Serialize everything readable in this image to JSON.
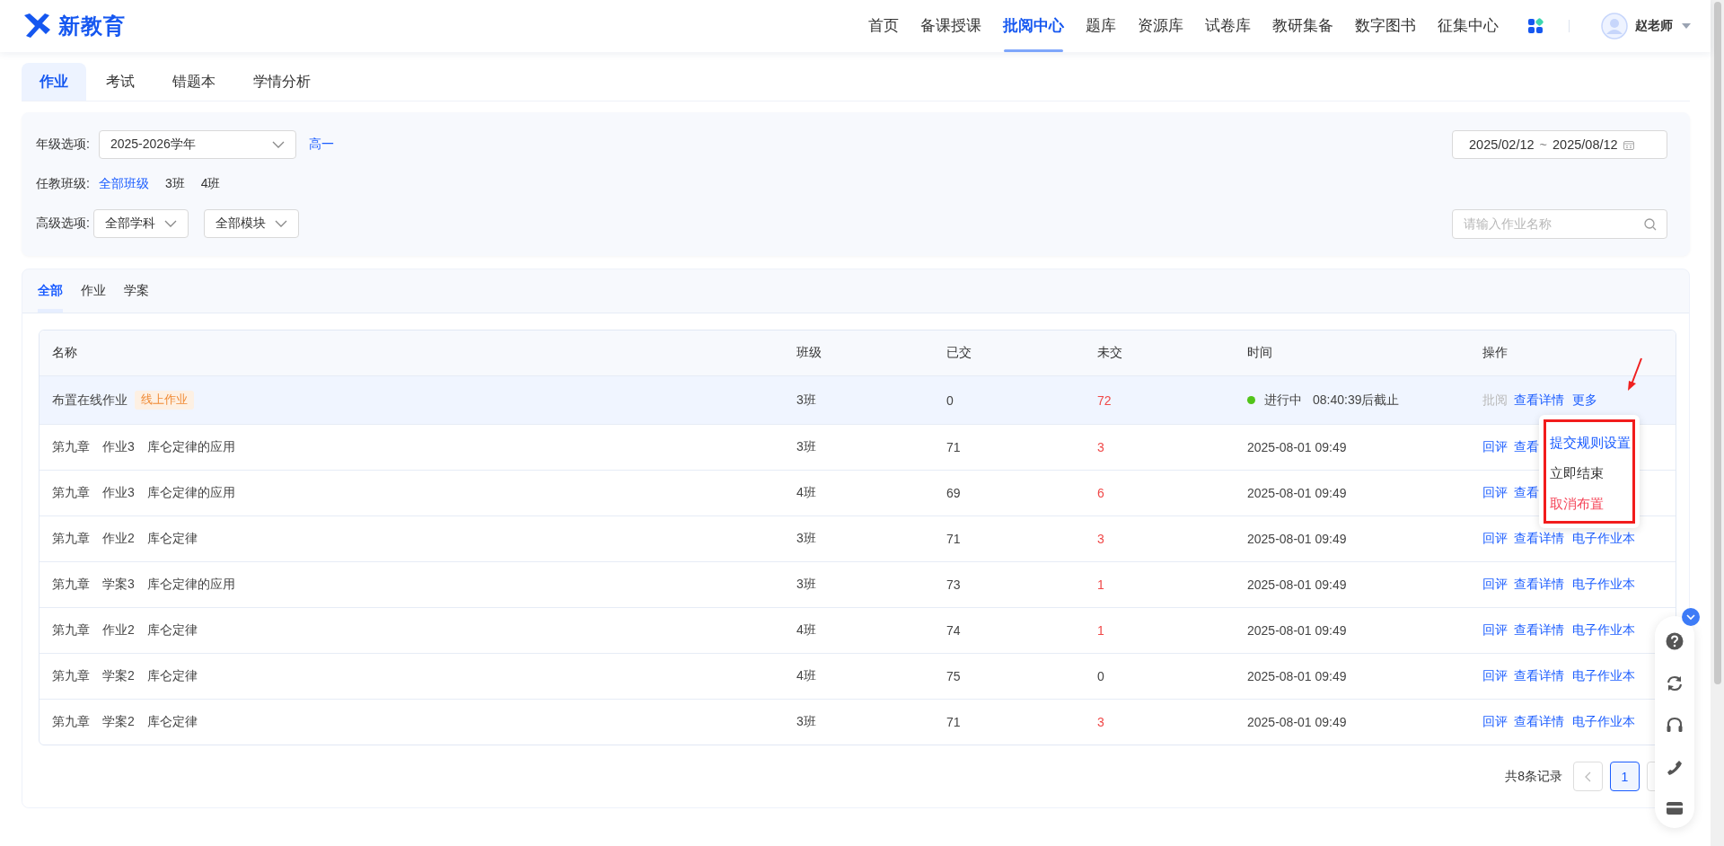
{
  "header": {
    "logo": "新教育",
    "nav": [
      {
        "label": "首页",
        "selected": false
      },
      {
        "label": "备课授课",
        "selected": false
      },
      {
        "label": "批阅中心",
        "selected": true
      },
      {
        "label": "题库",
        "selected": false
      },
      {
        "label": "资源库",
        "selected": false
      },
      {
        "label": "试卷库",
        "selected": false
      },
      {
        "label": "教研集备",
        "selected": false
      },
      {
        "label": "数字图书",
        "selected": false
      },
      {
        "label": "征集中心",
        "selected": false
      }
    ],
    "user": "赵老师"
  },
  "tabs": [
    {
      "label": "作业",
      "selected": true
    },
    {
      "label": "考试",
      "selected": false
    },
    {
      "label": "错题本",
      "selected": false
    },
    {
      "label": "学情分析",
      "selected": false
    }
  ],
  "filters": {
    "grade_label": "年级选项:",
    "grade_value": "2025-2026学年",
    "grade_link": "高一",
    "date_start": "2025/02/12",
    "date_sep": "~",
    "date_end": "2025/08/12",
    "class_label": "任教班级:",
    "classes": [
      {
        "label": "全部班级",
        "selected": true
      },
      {
        "label": "3班",
        "selected": false
      },
      {
        "label": "4班",
        "selected": false
      }
    ],
    "advanced_label": "高级选项:",
    "advanced": [
      "全部学科",
      "全部模块"
    ],
    "search": {
      "placeholder": "请输入作业名称"
    }
  },
  "list_tabs": [
    {
      "label": "全部",
      "selected": true
    },
    {
      "label": "作业",
      "selected": false
    },
    {
      "label": "学案",
      "selected": false
    }
  ],
  "table": {
    "columns": [
      "名称",
      "班级",
      "已交",
      "未交",
      "时间",
      "操作"
    ],
    "rows": [
      {
        "name": "布置在线作业",
        "tag": "线上作业",
        "class": "3班",
        "submitted": "0",
        "unsubmitted": "72",
        "alert": true,
        "status": {
          "text": "进行中",
          "color": "#52c41a"
        },
        "time": "08:40:39后截止",
        "selected": true,
        "actions": [
          {
            "label": "批阅",
            "disabled": true
          },
          {
            "label": "查看详情",
            "disabled": false
          },
          {
            "label": "更多",
            "disabled": false
          }
        ]
      },
      {
        "name": "第九章　作业3　库仑定律的应用",
        "class": "3班",
        "submitted": "71",
        "unsubmitted": "3",
        "alert": true,
        "time": "2025-08-01 09:49",
        "selected": false,
        "actions": [
          {
            "label": "回评",
            "disabled": false
          },
          {
            "label": "查看",
            "disabled": false
          }
        ]
      },
      {
        "name": "第九章　作业3　库仑定律的应用",
        "class": "4班",
        "submitted": "69",
        "unsubmitted": "6",
        "alert": true,
        "time": "2025-08-01 09:49",
        "selected": false,
        "actions": [
          {
            "label": "回评",
            "disabled": false
          },
          {
            "label": "查看",
            "disabled": false
          }
        ]
      },
      {
        "name": "第九章　作业2　库仑定律",
        "class": "3班",
        "submitted": "71",
        "unsubmitted": "3",
        "alert": true,
        "time": "2025-08-01 09:49",
        "selected": false,
        "actions": [
          {
            "label": "回评",
            "disabled": false
          },
          {
            "label": "查看详情",
            "disabled": false
          },
          {
            "label": "电子作业本",
            "disabled": false
          }
        ]
      },
      {
        "name": "第九章　学案3　库仑定律的应用",
        "class": "3班",
        "submitted": "73",
        "unsubmitted": "1",
        "alert": true,
        "time": "2025-08-01 09:49",
        "selected": false,
        "actions": [
          {
            "label": "回评",
            "disabled": false
          },
          {
            "label": "查看详情",
            "disabled": false
          },
          {
            "label": "电子作业本",
            "disabled": false
          }
        ]
      },
      {
        "name": "第九章　作业2　库仑定律",
        "class": "4班",
        "submitted": "74",
        "unsubmitted": "1",
        "alert": true,
        "time": "2025-08-01 09:49",
        "selected": false,
        "actions": [
          {
            "label": "回评",
            "disabled": false
          },
          {
            "label": "查看详情",
            "disabled": false
          },
          {
            "label": "电子作业本",
            "disabled": false
          }
        ]
      },
      {
        "name": "第九章　学案2　库仑定律",
        "class": "4班",
        "submitted": "75",
        "unsubmitted": "0",
        "alert": false,
        "time": "2025-08-01 09:49",
        "selected": false,
        "actions": [
          {
            "label": "回评",
            "disabled": false
          },
          {
            "label": "查看详情",
            "disabled": false
          },
          {
            "label": "电子作业本",
            "disabled": false
          }
        ]
      },
      {
        "name": "第九章　学案2　库仑定律",
        "class": "3班",
        "submitted": "71",
        "unsubmitted": "3",
        "alert": true,
        "time": "2025-08-01 09:49",
        "selected": false,
        "actions": [
          {
            "label": "回评",
            "disabled": false
          },
          {
            "label": "查看详情",
            "disabled": false
          },
          {
            "label": "电子作业本",
            "disabled": false
          }
        ]
      }
    ]
  },
  "more_menu": {
    "highlighted": true,
    "items": [
      {
        "label": "提交规则设置",
        "kind": "link"
      },
      {
        "label": "立即结束",
        "kind": "normal"
      },
      {
        "label": "取消布置",
        "kind": "danger"
      }
    ]
  },
  "pagination": {
    "total": "共8条记录",
    "pages": [
      {
        "label": "1",
        "selected": true
      }
    ]
  }
}
